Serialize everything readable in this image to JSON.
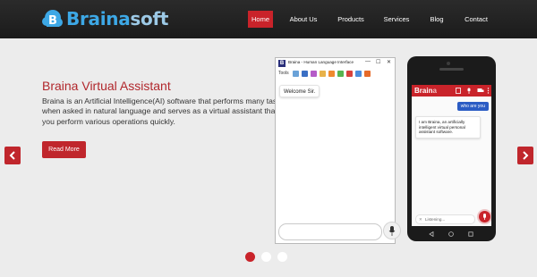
{
  "header": {
    "logo_text_part1": "Braina",
    "logo_text_part2": "soft",
    "logo_icon": "b-cloud-logo"
  },
  "nav": {
    "items": [
      {
        "label": "Home",
        "active": true
      },
      {
        "label": "About Us",
        "active": false
      },
      {
        "label": "Products",
        "active": false
      },
      {
        "label": "Services",
        "active": false
      },
      {
        "label": "Blog",
        "active": false
      },
      {
        "label": "Contact",
        "active": false
      }
    ]
  },
  "slide": {
    "title": "Braina Virtual Assistant",
    "description": "Braina is an Artificial Intelligence(AI) software that performs many tasks when asked in natural language and serves as a virtual assistant that helps you perform various operations quickly.",
    "button_label": "Read More",
    "prev_icon": "chevron-left-icon",
    "next_icon": "chevron-right-icon"
  },
  "desktop_app": {
    "window_title": "Braina - Human Language Interface",
    "window_icon_letter": "B",
    "controls": {
      "minimize": "—",
      "maximize": "☐",
      "close": "✕"
    },
    "tools_label": "Tools",
    "assistant_message": "Welcome Sir."
  },
  "phone_app": {
    "brand_part1": "Brain",
    "brand_part2": "a",
    "user_message": "who are you",
    "assistant_message": "I am Braina, an artificially intelligent virtual personal assistant software.",
    "listening_text": "Listening...",
    "listening_close": "✕"
  },
  "carousel": {
    "slide_count": 3,
    "active_index": 0
  },
  "colors": {
    "brand_red": "#c9232a",
    "header_bg": "#222222",
    "logo_blue": "#3da8e6"
  }
}
